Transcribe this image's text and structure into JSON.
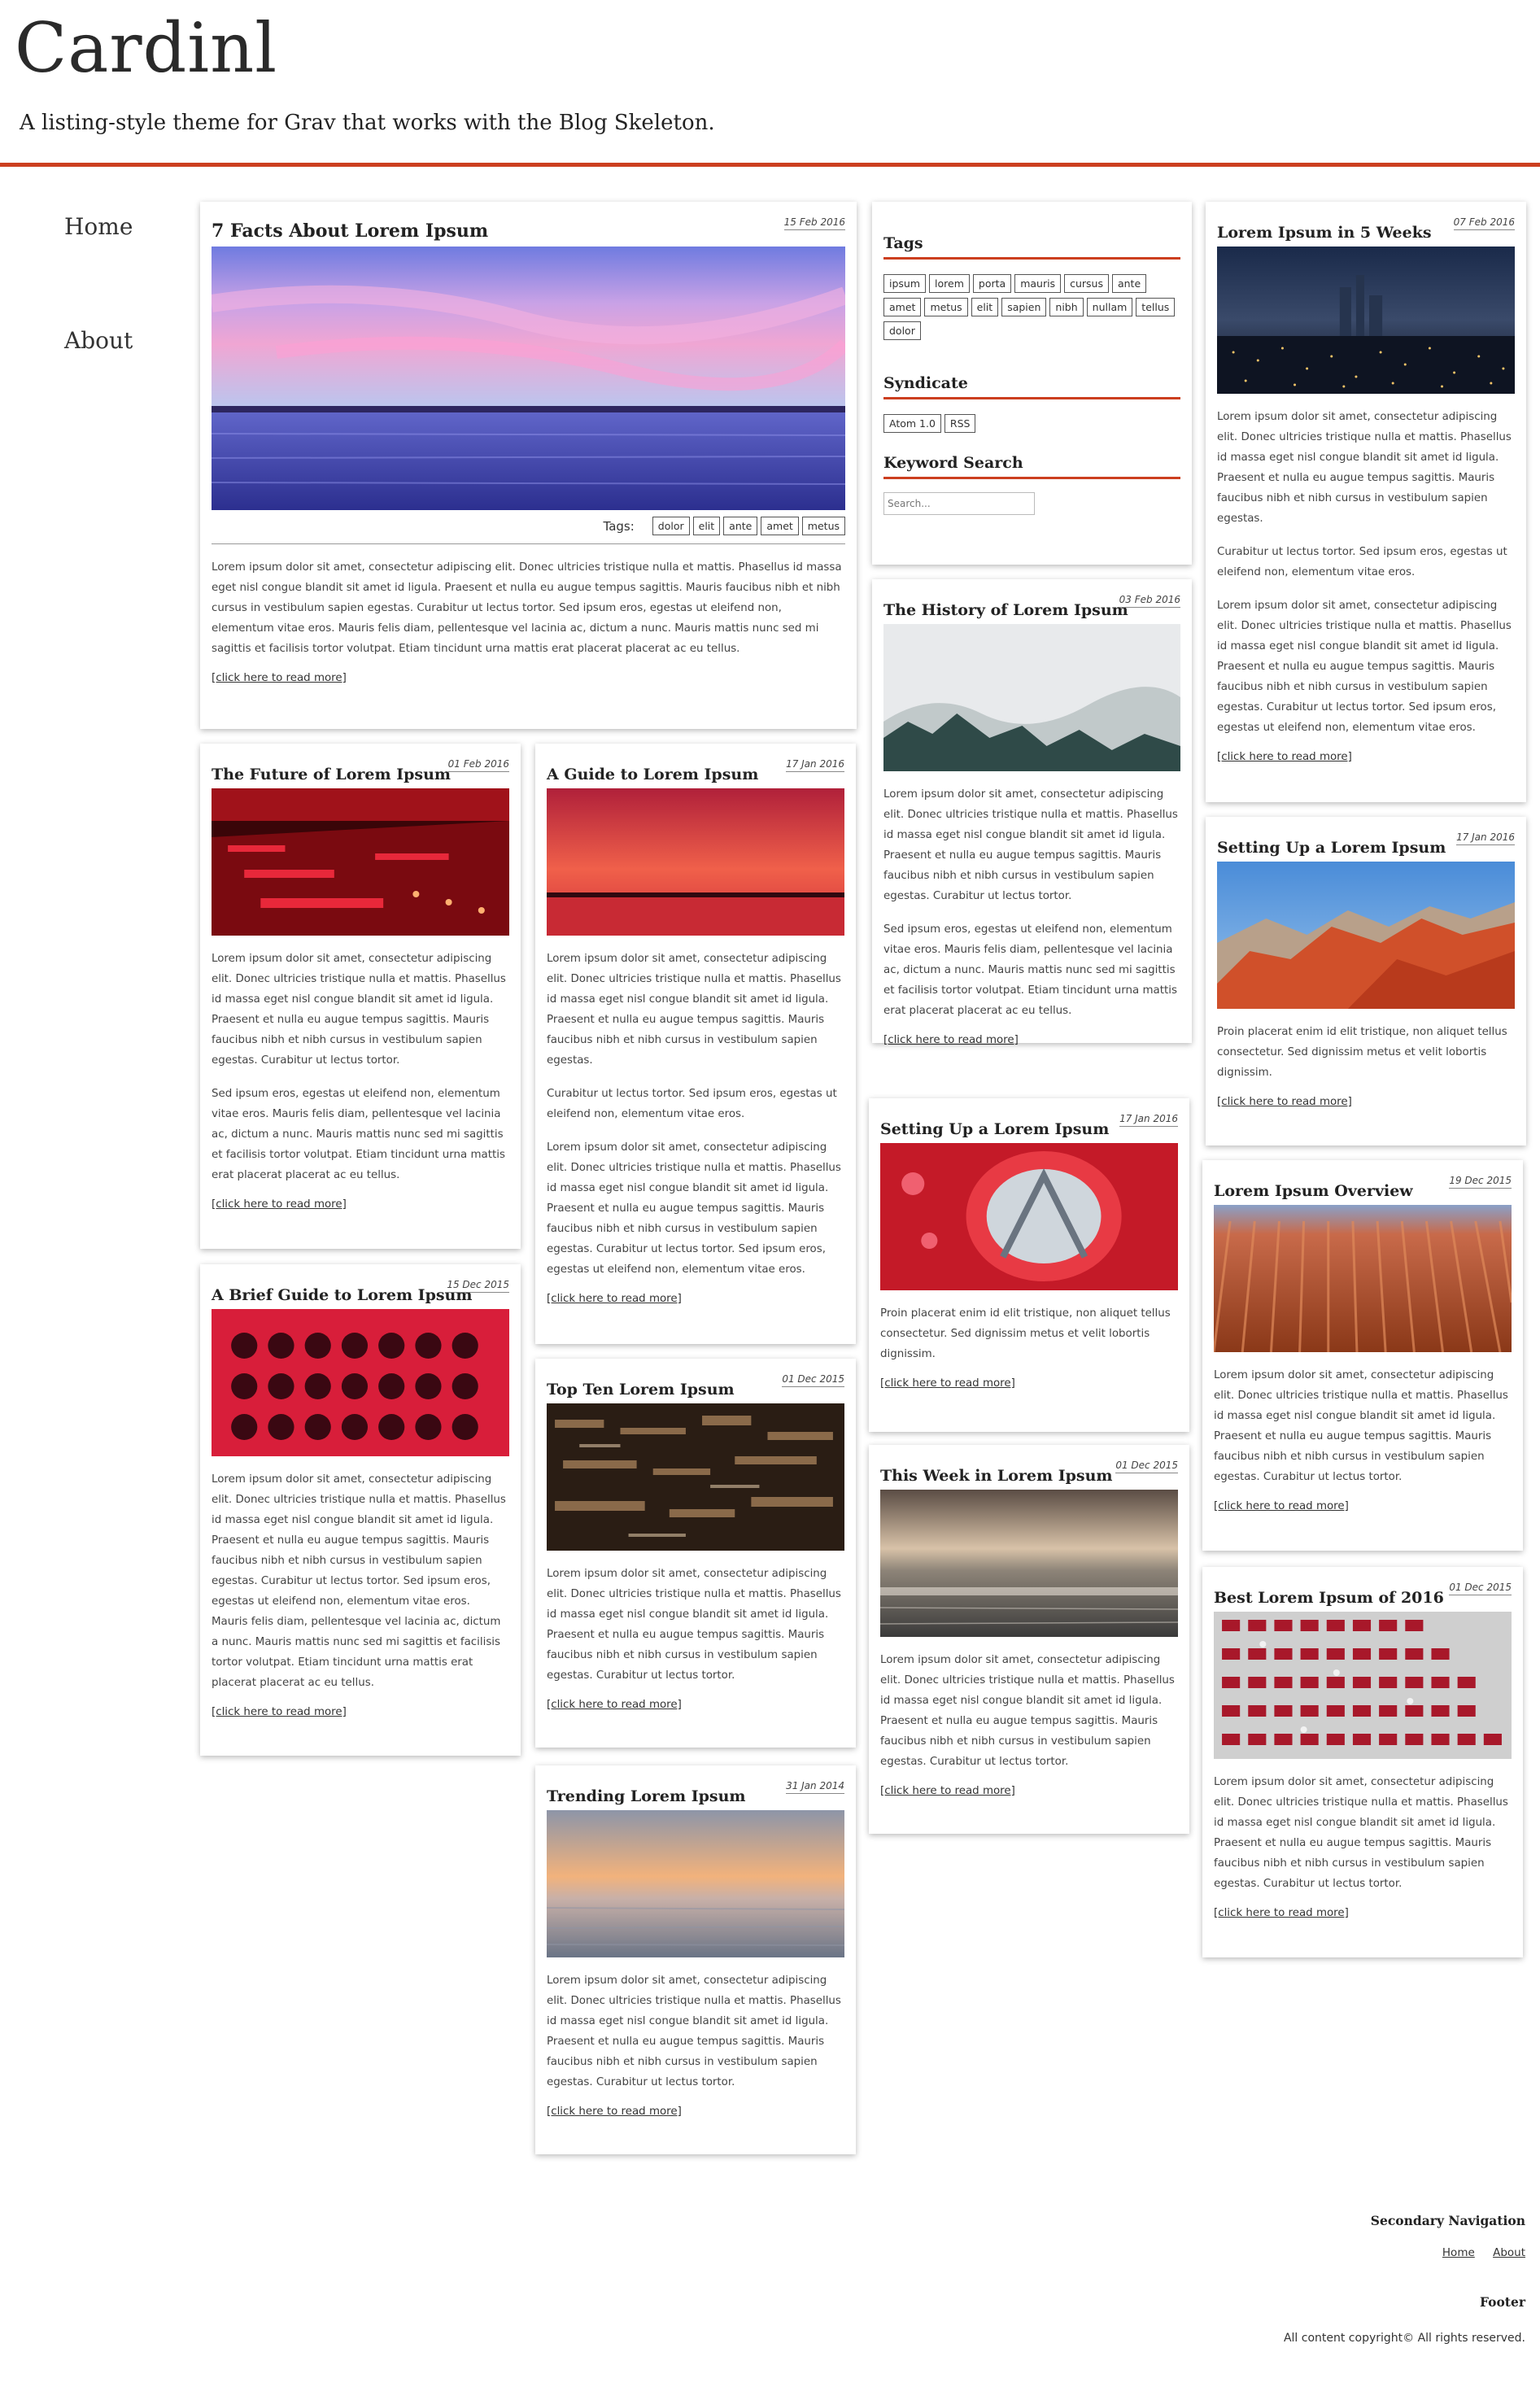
{
  "site": {
    "title": "Cardinl",
    "tagline": "A listing-style theme for Grav that works with the Blog Skeleton.",
    "accent_color": "#cc3f1f"
  },
  "nav": [
    {
      "label": "Home"
    },
    {
      "label": "About"
    }
  ],
  "featured": {
    "title": "7 Facts About Lorem Ipsum",
    "date": "15 Feb 2016",
    "tags_label": "Tags:",
    "tags": [
      "dolor",
      "elit",
      "ante",
      "amet",
      "metus"
    ],
    "body": "Lorem ipsum dolor sit amet, consectetur adipiscing elit. Donec ultricies tristique nulla et mattis. Phasellus id massa eget nisl congue blandit sit amet id ligula. Praesent et nulla eu augue tempus sagittis. Mauris faucibus nibh et nibh cursus in vestibulum sapien egestas. Curabitur ut lectus tortor. Sed ipsum eros, egestas ut eleifend non, elementum vitae eros. Mauris felis diam, pellentesque vel lacinia ac, dictum a nunc. Mauris mattis nunc sed mi sagittis et facilisis tortor volutpat. Etiam tincidunt urna mattis erat placerat placerat ac eu tellus.",
    "more": "[click here to read more]"
  },
  "sidebar": {
    "tags_heading": "Tags",
    "tags": [
      "ipsum",
      "lorem",
      "porta",
      "mauris",
      "cursus",
      "ante",
      "amet",
      "metus",
      "elit",
      "sapien",
      "nibh",
      "nullam",
      "tellus",
      "dolor"
    ],
    "syndicate_heading": "Syndicate",
    "syndicate": [
      "Atom 1.0",
      "RSS"
    ],
    "search_heading": "Keyword Search",
    "search_placeholder": "Search..."
  },
  "posts": [
    {
      "title": "The Future of Lorem Ipsum",
      "date": "01 Feb 2016",
      "body": [
        "Lorem ipsum dolor sit amet, consectetur adipiscing elit. Donec ultricies tristique nulla et mattis. Phasellus id massa eget nisl congue blandit sit amet id ligula. Praesent et nulla eu augue tempus sagittis. Mauris faucibus nibh et nibh cursus in vestibulum sapien egestas. Curabitur ut lectus tortor.",
        "Sed ipsum eros, egestas ut eleifend non, elementum vitae eros. Mauris felis diam, pellentesque vel lacinia ac, dictum a nunc. Mauris mattis nunc sed mi sagittis et facilisis tortor volutpat. Etiam tincidunt urna mattis erat placerat placerat ac eu tellus."
      ],
      "more": "[click here to read more]"
    },
    {
      "title": "A Brief Guide to Lorem Ipsum",
      "date": "15 Dec 2015",
      "body": [
        "Lorem ipsum dolor sit amet, consectetur adipiscing elit. Donec ultricies tristique nulla et mattis. Phasellus id massa eget nisl congue blandit sit amet id ligula. Praesent et nulla eu augue tempus sagittis. Mauris faucibus nibh et nibh cursus in vestibulum sapien egestas. Curabitur ut lectus tortor. Sed ipsum eros, egestas ut eleifend non, elementum vitae eros. Mauris felis diam, pellentesque vel lacinia ac, dictum a nunc. Mauris mattis nunc sed mi sagittis et facilisis tortor volutpat. Etiam tincidunt urna mattis erat placerat placerat ac eu tellus."
      ],
      "more": "[click here to read more]"
    },
    {
      "title": "A Guide to Lorem Ipsum",
      "date": "17 Jan 2016",
      "body": [
        "Lorem ipsum dolor sit amet, consectetur adipiscing elit. Donec ultricies tristique nulla et mattis. Phasellus id massa eget nisl congue blandit sit amet id ligula. Praesent et nulla eu augue tempus sagittis. Mauris faucibus nibh et nibh cursus in vestibulum sapien egestas.",
        "Curabitur ut lectus tortor. Sed ipsum eros, egestas ut eleifend non, elementum vitae eros.",
        "Lorem ipsum dolor sit amet, consectetur adipiscing elit. Donec ultricies tristique nulla et mattis. Phasellus id massa eget nisl congue blandit sit amet id ligula. Praesent et nulla eu augue tempus sagittis. Mauris faucibus nibh et nibh cursus in vestibulum sapien egestas. Curabitur ut lectus tortor. Sed ipsum eros, egestas ut eleifend non, elementum vitae eros."
      ],
      "more": "[click here to read more]"
    },
    {
      "title": "Top Ten Lorem Ipsum",
      "date": "01 Dec 2015",
      "body": [
        "Lorem ipsum dolor sit amet, consectetur adipiscing elit. Donec ultricies tristique nulla et mattis. Phasellus id massa eget nisl congue blandit sit amet id ligula. Praesent et nulla eu augue tempus sagittis. Mauris faucibus nibh et nibh cursus in vestibulum sapien egestas. Curabitur ut lectus tortor."
      ],
      "more": "[click here to read more]"
    },
    {
      "title": "Trending Lorem Ipsum",
      "date": "31 Jan 2014",
      "body": [
        "Lorem ipsum dolor sit amet, consectetur adipiscing elit. Donec ultricies tristique nulla et mattis. Phasellus id massa eget nisl congue blandit sit amet id ligula. Praesent et nulla eu augue tempus sagittis. Mauris faucibus nibh et nibh cursus in vestibulum sapien egestas. Curabitur ut lectus tortor."
      ],
      "more": "[click here to read more]"
    },
    {
      "title": "The History of Lorem Ipsum",
      "date": "03 Feb 2016",
      "body": [
        "Lorem ipsum dolor sit amet, consectetur adipiscing elit. Donec ultricies tristique nulla et mattis. Phasellus id massa eget nisl congue blandit sit amet id ligula. Praesent et nulla eu augue tempus sagittis. Mauris faucibus nibh et nibh cursus in vestibulum sapien egestas. Curabitur ut lectus tortor.",
        "Sed ipsum eros, egestas ut eleifend non, elementum vitae eros. Mauris felis diam, pellentesque vel lacinia ac, dictum a nunc. Mauris mattis nunc sed mi sagittis et facilisis tortor volutpat. Etiam tincidunt urna mattis erat placerat placerat ac eu tellus."
      ],
      "more": "[click here to read more]"
    },
    {
      "title": "Setting Up a Lorem Ipsum",
      "date": "17 Jan 2016",
      "body": [
        "Proin placerat enim id elit tristique, non aliquet tellus consectetur. Sed dignissim metus et velit lobortis dignissim."
      ],
      "more": "[click here to read more]"
    },
    {
      "title": "This Week in Lorem Ipsum",
      "date": "01 Dec 2015",
      "body": [
        "Lorem ipsum dolor sit amet, consectetur adipiscing elit. Donec ultricies tristique nulla et mattis. Phasellus id massa eget nisl congue blandit sit amet id ligula. Praesent et nulla eu augue tempus sagittis. Mauris faucibus nibh et nibh cursus in vestibulum sapien egestas. Curabitur ut lectus tortor."
      ],
      "more": "[click here to read more]"
    },
    {
      "title": "Lorem Ipsum in 5 Weeks",
      "date": "07 Feb 2016",
      "body": [
        "Lorem ipsum dolor sit amet, consectetur adipiscing elit. Donec ultricies tristique nulla et mattis. Phasellus id massa eget nisl congue blandit sit amet id ligula. Praesent et nulla eu augue tempus sagittis. Mauris faucibus nibh et nibh cursus in vestibulum sapien egestas.",
        "Curabitur ut lectus tortor. Sed ipsum eros, egestas ut eleifend non, elementum vitae eros.",
        "Lorem ipsum dolor sit amet, consectetur adipiscing elit. Donec ultricies tristique nulla et mattis. Phasellus id massa eget nisl congue blandit sit amet id ligula. Praesent et nulla eu augue tempus sagittis. Mauris faucibus nibh et nibh cursus in vestibulum sapien egestas. Curabitur ut lectus tortor. Sed ipsum eros, egestas ut eleifend non, elementum vitae eros."
      ],
      "more": "[click here to read more]"
    },
    {
      "title": "Setting Up a Lorem Ipsum",
      "date": "17 Jan 2016",
      "body": [
        "Proin placerat enim id elit tristique, non aliquet tellus consectetur. Sed dignissim metus et velit lobortis dignissim."
      ],
      "more": "[click here to read more]"
    },
    {
      "title": "Lorem Ipsum Overview",
      "date": "19 Dec 2015",
      "body": [
        "Lorem ipsum dolor sit amet, consectetur adipiscing elit. Donec ultricies tristique nulla et mattis. Phasellus id massa eget nisl congue blandit sit amet id ligula. Praesent et nulla eu augue tempus sagittis. Mauris faucibus nibh et nibh cursus in vestibulum sapien egestas. Curabitur ut lectus tortor."
      ],
      "more": "[click here to read more]"
    },
    {
      "title": "Best Lorem Ipsum of 2016",
      "date": "01 Dec 2015",
      "body": [
        "Lorem ipsum dolor sit amet, consectetur adipiscing elit. Donec ultricies tristique nulla et mattis. Phasellus id massa eget nisl congue blandit sit amet id ligula. Praesent et nulla eu augue tempus sagittis. Mauris faucibus nibh et nibh cursus in vestibulum sapien egestas. Curabitur ut lectus tortor."
      ],
      "more": "[click here to read more]"
    }
  ],
  "footer": {
    "secondary_nav_label": "Secondary Navigation",
    "links": [
      "Home",
      "About"
    ],
    "footer_label": "Footer",
    "copyright": "All content copyright© All rights reserved."
  }
}
